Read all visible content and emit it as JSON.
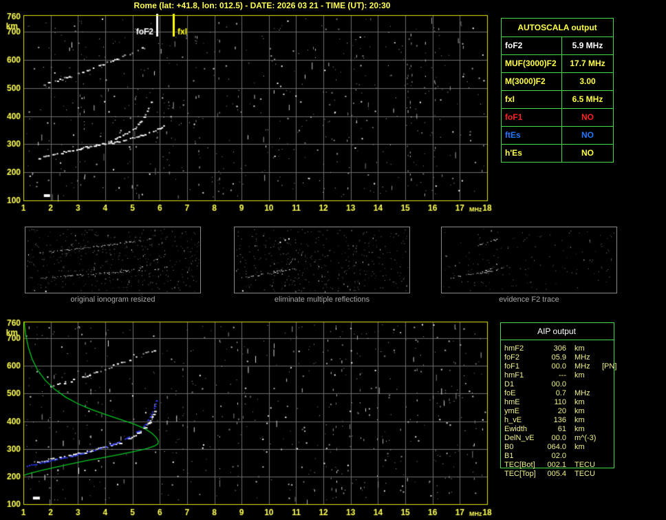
{
  "title": "Rome (lat: +41.8, lon: 012.5) - DATE: 2026 03 21 - TIME (UT): 20:30",
  "colors": {
    "title_yellow": "#ffff55",
    "axis_label_yellow": "#ffff55",
    "plot_border_yellow": "#e6e600",
    "grid_gray": "#6f6f6f",
    "table_border_green": "#44dd44",
    "profile_green": "#00cc22",
    "model_trace_blue": "#3340ff",
    "trace_white": "#ffffff",
    "caption_gray": "#a8a8a8",
    "marker_fof2_white": "#ffffff",
    "marker_fxi_yellow": "#ffff00",
    "status_red": "#ff2222",
    "status_blue": "#2277ff",
    "table_text_yellow": "#ffff47",
    "aip_text_yellow": "#f2f28c"
  },
  "autoscala": {
    "header": "AUTOSCALA output",
    "rows": [
      {
        "label": "foF2",
        "value": "5.9 MHz",
        "color": "#ffffff"
      },
      {
        "label": "MUF(3000)F2",
        "value": "17.7 MHz",
        "color": "#ffff47"
      },
      {
        "label": "M(3000)F2",
        "value": "3.00",
        "color": "#ffff47"
      },
      {
        "label": "fxI",
        "value": "6.5 MHz",
        "color": "#ffff47"
      },
      {
        "label": "foF1",
        "value": "NO",
        "color": "#ff2222"
      },
      {
        "label": "ftEs",
        "value": "NO",
        "color": "#2277ff"
      },
      {
        "label": "h'Es",
        "value": "NO",
        "color": "#ffff47"
      }
    ]
  },
  "aip": {
    "header": "AIP output",
    "rows": [
      {
        "label": "hmF2",
        "value": "306",
        "unit": "km",
        "note": ""
      },
      {
        "label": "foF2",
        "value": "05.9",
        "unit": "MHz",
        "note": ""
      },
      {
        "label": "foF1",
        "value": "00.0",
        "unit": "MHz",
        "note": "[PN]"
      },
      {
        "label": "hmF1",
        "value": "---",
        "unit": "km",
        "note": ""
      },
      {
        "label": "D1",
        "value": "00.0",
        "unit": "",
        "note": ""
      },
      {
        "label": "foE",
        "value": "0.7",
        "unit": "MHz",
        "note": ""
      },
      {
        "label": "hmE",
        "value": "110",
        "unit": "km",
        "note": ""
      },
      {
        "label": "ymE",
        "value": "20",
        "unit": "km",
        "note": ""
      },
      {
        "label": "h_vE",
        "value": "136",
        "unit": "km",
        "note": ""
      },
      {
        "label": "Ewidth",
        "value": "61",
        "unit": "km",
        "note": ""
      },
      {
        "label": "DelN_vE",
        "value": "00.0",
        "unit": "m^(-3)",
        "note": ""
      },
      {
        "label": "B0",
        "value": "064.0",
        "unit": "km",
        "note": ""
      },
      {
        "label": "B1",
        "value": "02.0",
        "unit": "",
        "note": ""
      },
      {
        "label": "TEC[Bot]",
        "value": "002.1",
        "unit": "TECU",
        "note": ""
      },
      {
        "label": "TEC[Top]",
        "value": "005.4",
        "unit": "TECU",
        "note": ""
      }
    ]
  },
  "thumbnails": [
    {
      "caption": "original ionogram resized"
    },
    {
      "caption": "eliminate multiple reflections"
    },
    {
      "caption": "evidence F2 trace"
    }
  ],
  "chart_data": {
    "type": "scatter",
    "title": "Night-time ionogram autoscaled by AUTOSCALA with AIP electron density profile",
    "xlabel": "MHz",
    "ylabel": "km",
    "x_range": [
      1,
      18
    ],
    "y_range": [
      100,
      760
    ],
    "x_ticks": [
      1,
      2,
      3,
      4,
      5,
      6,
      7,
      8,
      9,
      10,
      11,
      12,
      13,
      14,
      15,
      16,
      17,
      18
    ],
    "y_ticks": [
      760,
      700,
      600,
      500,
      400,
      300,
      200,
      100
    ],
    "grid": true,
    "legend": "none",
    "key_values": {
      "foF2_MHz": 5.9,
      "fxI_MHz": 6.5,
      "hmF2_km": 306,
      "MUF3000F2_MHz": 17.7,
      "M3000F2": 3.0
    },
    "trace_library": {
      "f2_trace": {
        "color": "#ffffff",
        "style": "blocks",
        "size": 3,
        "gap": 0.12,
        "jitter": 1.4,
        "points": [
          [
            1.55,
            250
          ],
          [
            1.9,
            258
          ],
          [
            2.3,
            267
          ],
          [
            2.7,
            276
          ],
          [
            3.1,
            284
          ],
          [
            3.5,
            293
          ],
          [
            3.95,
            303
          ]
        ]
      },
      "f2_cusp_upper": {
        "color": "#ffffff",
        "style": "blocks",
        "size": 2,
        "gap": 0.25,
        "jitter": 1.2,
        "points": [
          [
            3.95,
            303
          ],
          [
            4.35,
            318
          ],
          [
            4.7,
            334
          ],
          [
            5.0,
            352
          ],
          [
            5.25,
            375
          ],
          [
            5.45,
            403
          ],
          [
            5.6,
            432
          ],
          [
            5.7,
            455
          ]
        ]
      },
      "f2_cusp_lower": {
        "color": "#ffffff",
        "style": "blocks",
        "size": 2,
        "gap": 0.22,
        "jitter": 1.2,
        "points": [
          [
            3.95,
            297
          ],
          [
            4.4,
            308
          ],
          [
            4.9,
            320
          ],
          [
            5.35,
            333
          ],
          [
            5.75,
            347
          ],
          [
            6.05,
            359
          ],
          [
            6.2,
            366
          ]
        ]
      },
      "second_order_trace": {
        "color": "#e8e8e8",
        "style": "blocks",
        "size": 2,
        "gap": 0.45,
        "jitter": 1.8,
        "dim": true,
        "points": [
          [
            1.5,
            503
          ],
          [
            1.9,
            516
          ],
          [
            2.4,
            531
          ],
          [
            2.9,
            548
          ],
          [
            3.4,
            565
          ],
          [
            3.9,
            583
          ],
          [
            4.4,
            602
          ],
          [
            4.9,
            622
          ],
          [
            5.25,
            636
          ],
          [
            5.5,
            648
          ]
        ]
      },
      "f2_trace_b": {
        "color": "#ffffff",
        "style": "blocks",
        "size": 3,
        "gap": 0.15,
        "jitter": 1.4,
        "points": [
          [
            1.5,
            252
          ],
          [
            1.9,
            260
          ],
          [
            2.4,
            270
          ],
          [
            2.9,
            280
          ],
          [
            3.4,
            291
          ],
          [
            3.9,
            303
          ],
          [
            4.35,
            316
          ],
          [
            4.75,
            331
          ],
          [
            5.1,
            349
          ],
          [
            5.4,
            372
          ],
          [
            5.6,
            398
          ],
          [
            5.75,
            425
          ],
          [
            5.83,
            443
          ]
        ]
      },
      "second_order_trace_b": {
        "color": "#e0e0e0",
        "style": "blocks",
        "size": 2,
        "gap": 0.5,
        "jitter": 1.8,
        "dim": true,
        "points": [
          [
            1.9,
            522
          ],
          [
            2.4,
            536
          ],
          [
            2.9,
            551
          ],
          [
            3.4,
            567
          ],
          [
            3.9,
            584
          ],
          [
            4.35,
            602
          ],
          [
            4.8,
            620
          ],
          [
            5.2,
            637
          ],
          [
            5.55,
            650
          ],
          [
            5.85,
            658
          ]
        ]
      },
      "model_trace_blue": {
        "color": "#3340ff",
        "style": "plus",
        "size": 2,
        "gap": 0.3,
        "jitter": 0.8,
        "points": [
          [
            1.15,
            238
          ],
          [
            1.55,
            246
          ],
          [
            2.0,
            256
          ],
          [
            2.45,
            266
          ],
          [
            2.9,
            276
          ],
          [
            3.35,
            288
          ],
          [
            3.8,
            300
          ],
          [
            4.2,
            313
          ],
          [
            4.6,
            328
          ],
          [
            4.95,
            345
          ],
          [
            5.25,
            365
          ],
          [
            5.5,
            390
          ],
          [
            5.67,
            415
          ],
          [
            5.78,
            440
          ],
          [
            5.86,
            462
          ],
          [
            5.92,
            483
          ],
          [
            5.95,
            495
          ]
        ]
      },
      "density_profile_green": {
        "color": "#00cc22",
        "style": "line",
        "size": 1.3,
        "points": [
          [
            1.03,
            758
          ],
          [
            1.08,
            715
          ],
          [
            1.18,
            668
          ],
          [
            1.32,
            625
          ],
          [
            1.52,
            585
          ],
          [
            1.8,
            548
          ],
          [
            2.15,
            515
          ],
          [
            2.55,
            487
          ],
          [
            3.0,
            463
          ],
          [
            3.5,
            442
          ],
          [
            4.05,
            423
          ],
          [
            4.6,
            405
          ],
          [
            5.05,
            390
          ],
          [
            5.45,
            373
          ],
          [
            5.72,
            356
          ],
          [
            5.88,
            340
          ],
          [
            5.95,
            327
          ],
          [
            5.93,
            318
          ],
          [
            5.8,
            310
          ],
          [
            5.5,
            300
          ],
          [
            5.05,
            290
          ],
          [
            4.5,
            279
          ],
          [
            3.9,
            268
          ],
          [
            3.3,
            257
          ],
          [
            2.7,
            245
          ],
          [
            2.15,
            233
          ],
          [
            1.7,
            223
          ],
          [
            1.35,
            214
          ],
          [
            1.12,
            208
          ],
          [
            1.02,
            204
          ]
        ]
      }
    },
    "top_plot": {
      "traces": [
        "second_order_trace",
        "f2_trace",
        "f2_cusp_upper",
        "f2_cusp_lower"
      ],
      "markers": [
        {
          "f": 5.9,
          "label": "foF2",
          "color": "#ffffff",
          "side": "left"
        },
        {
          "f": 6.5,
          "label": "fxI",
          "color": "#ffff00",
          "side": "right"
        }
      ],
      "noise_seed": 11,
      "noise_count": 540,
      "blobs": [
        [
          1.75,
          122,
          9,
          4
        ]
      ]
    },
    "bottom_plot": {
      "traces": [
        "second_order_trace_b",
        "density_profile_green",
        "f2_trace_b",
        "model_trace_blue"
      ],
      "markers": [],
      "noise_seed": 23,
      "noise_count": 540,
      "blobs": [
        [
          1.35,
          127,
          10,
          4
        ]
      ]
    },
    "thumb_plots": [
      {
        "x_range": [
          1,
          7.2
        ],
        "y_range": [
          100,
          760
        ],
        "traces": [
          "second_order_trace",
          "f2_trace",
          "f2_cusp_upper",
          "f2_cusp_lower"
        ],
        "fragments": [],
        "noise_seed": 31,
        "noise_count": 400,
        "extra_dots": [
          [
            1.7,
            120
          ]
        ]
      },
      {
        "x_range": [
          1,
          15
        ],
        "y_range": [
          100,
          760
        ],
        "traces": [
          "f2_trace",
          "f2_cusp_upper",
          "f2_cusp_lower"
        ],
        "fragments": [],
        "noise_seed": 37,
        "noise_count": 380,
        "extra_dots": [
          [
            4.6,
            615
          ],
          [
            5.0,
            638
          ],
          [
            5.3,
            650
          ],
          [
            1.6,
            125
          ]
        ]
      },
      {
        "x_range": [
          1,
          15
        ],
        "y_range": [
          100,
          760
        ],
        "traces": [
          "f2_trace",
          "f2_cusp_upper",
          "f2_cusp_lower"
        ],
        "fragments": [
          [
            "second_order_trace",
            0.55,
            1.0
          ]
        ],
        "noise_seed": 41,
        "noise_count": 150,
        "extra_dots": []
      }
    ]
  }
}
